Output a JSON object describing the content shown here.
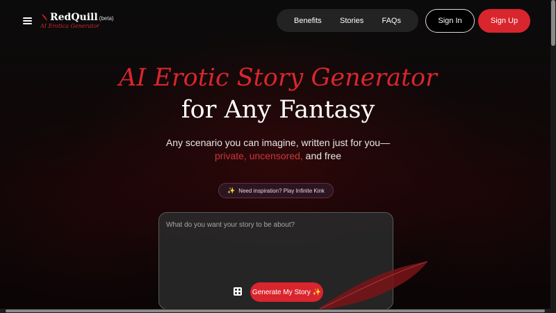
{
  "brand": {
    "name": "RedQuill",
    "beta": "(beta)",
    "tagline": "AI Erotica Generator"
  },
  "nav": {
    "links": [
      "Benefits",
      "Stories",
      "FAQs"
    ],
    "signin_label": "Sign In",
    "signup_label": "Sign Up"
  },
  "hero": {
    "title_line1": "AI Erotic Story Generator",
    "title_line2": "for Any Fantasy",
    "subtitle_line1": "Any scenario you can imagine, written just for you—",
    "subtitle_accent": "private, uncensored,",
    "subtitle_end": " and free"
  },
  "inspiration": {
    "icon": "sparkle-icon",
    "label": "Need inspiration? Play Infinite Kink"
  },
  "prompt": {
    "placeholder": "What do you want your story to be about?",
    "value": "",
    "generate_label": "Generate My Story ✨",
    "random_icon": "dice-icon"
  },
  "colors": {
    "accent": "#d9252d",
    "background": "#0a0a0a",
    "nav_pill": "#232323"
  }
}
